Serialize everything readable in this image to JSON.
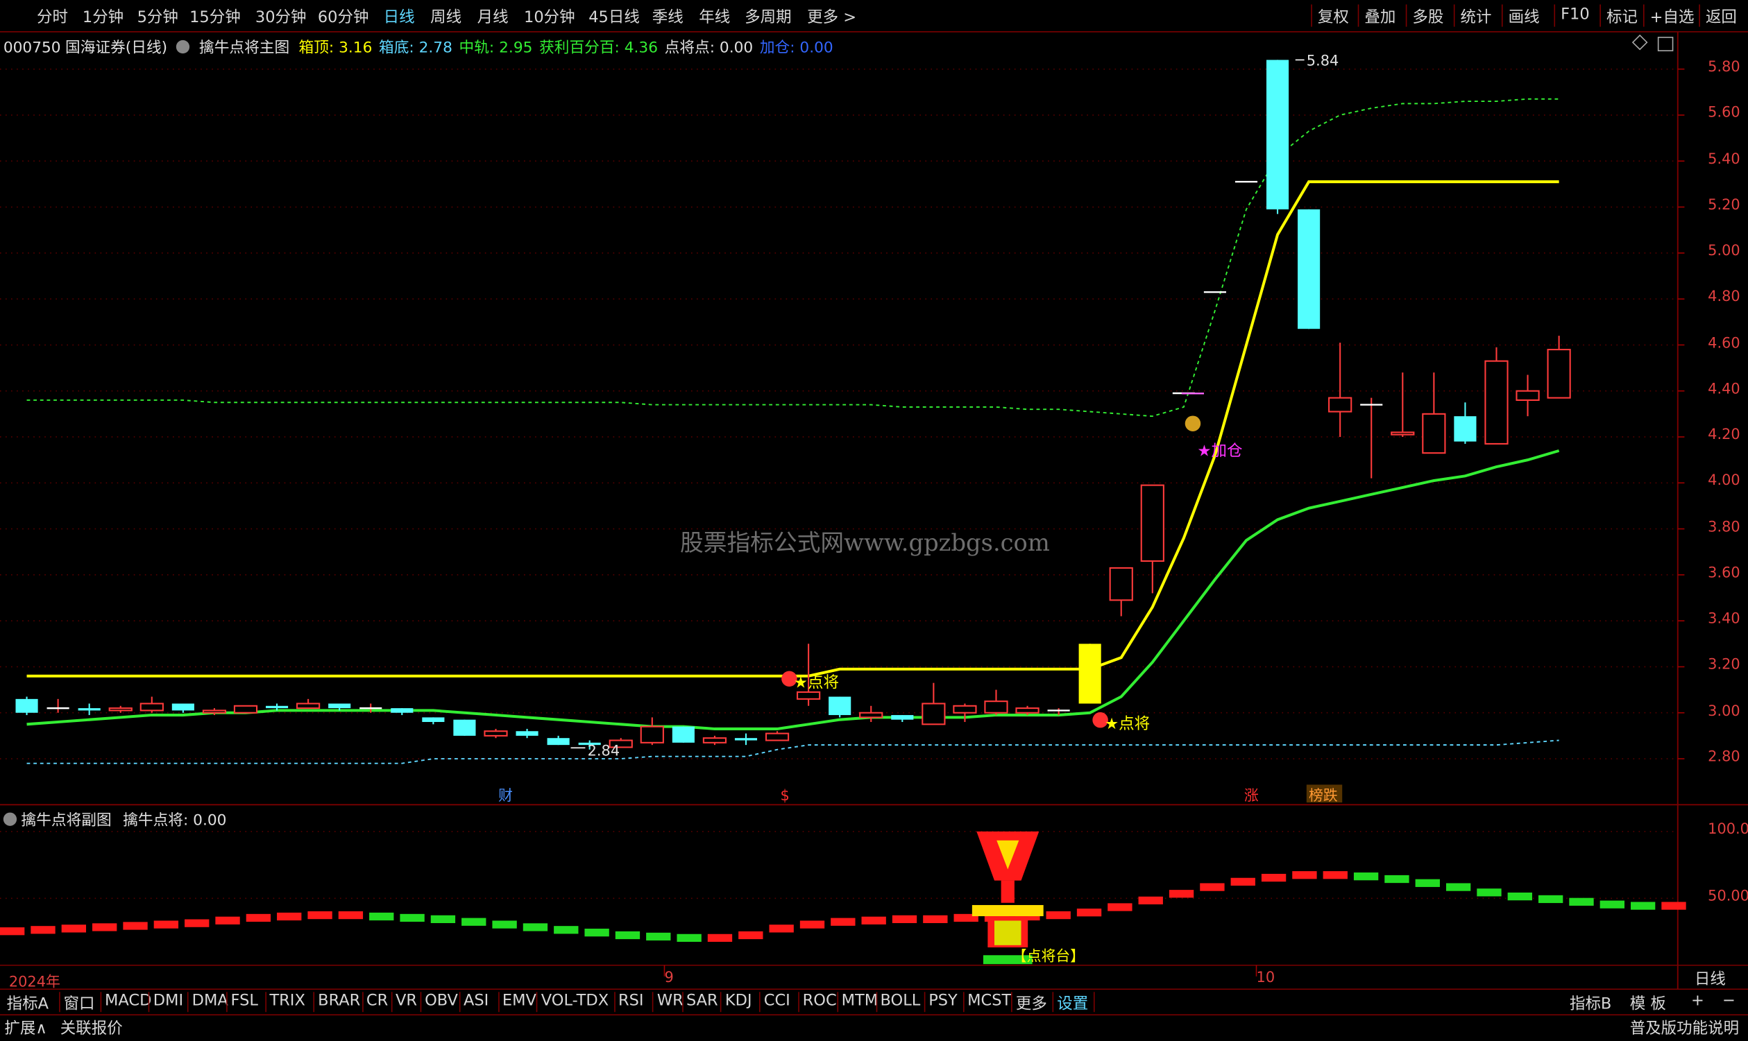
{
  "toolbar": {
    "periods": [
      "分时",
      "1分钟",
      "5分钟",
      "15分钟",
      "30分钟",
      "60分钟",
      "日线",
      "周线",
      "月线",
      "10分钟",
      "45日线",
      "季线",
      "年线",
      "多周期",
      "更多 >"
    ],
    "active_period": "日线",
    "right": [
      "复权",
      "叠加",
      "多股",
      "统计",
      "画线",
      "F10",
      "标记",
      "+自选",
      "返回"
    ]
  },
  "header": {
    "code": "000750",
    "name": "国海证券(日线)",
    "indicator": "擒牛点将主图",
    "items": [
      {
        "label": "箱顶: 3.16",
        "color": "#ffff00"
      },
      {
        "label": "箱底: 2.78",
        "color": "#5fd7ff"
      },
      {
        "label": "中轨: 2.95",
        "color": "#33ee33"
      },
      {
        "label": "获利百分百: 4.36",
        "color": "#33ee33"
      },
      {
        "label": "点将点: 0.00",
        "color": "#e0e0e0"
      },
      {
        "label": "加仓: 0.00",
        "color": "#3366ff"
      }
    ]
  },
  "watermark": "股票指标公式网www.gpzbgs.com",
  "chart_data": [
    {
      "type": "candlestick",
      "title": "擒牛点将主图",
      "ylim": [
        2.7,
        5.9
      ],
      "yticks": [
        "5.80",
        "5.60",
        "5.40",
        "5.20",
        "5.00",
        "4.80",
        "4.60",
        "4.40",
        "4.20",
        "4.00",
        "3.80",
        "3.60",
        "3.40",
        "3.20",
        "3.00",
        "2.80"
      ],
      "candles": [
        {
          "o": 3.06,
          "c": 3.0,
          "h": 3.07,
          "l": 2.99
        },
        {
          "o": 3.02,
          "c": 3.02,
          "h": 3.06,
          "l": 3.0
        },
        {
          "o": 3.02,
          "c": 3.01,
          "h": 3.04,
          "l": 2.99
        },
        {
          "o": 3.01,
          "c": 3.02,
          "h": 3.03,
          "l": 3.0
        },
        {
          "o": 3.01,
          "c": 3.04,
          "h": 3.07,
          "l": 3.0
        },
        {
          "o": 3.04,
          "c": 3.01,
          "h": 3.04,
          "l": 3.0
        },
        {
          "o": 3.0,
          "c": 3.01,
          "h": 3.02,
          "l": 2.99
        },
        {
          "o": 3.0,
          "c": 3.03,
          "h": 3.03,
          "l": 3.0
        },
        {
          "o": 3.03,
          "c": 3.02,
          "h": 3.04,
          "l": 3.01
        },
        {
          "o": 3.02,
          "c": 3.04,
          "h": 3.06,
          "l": 3.02
        },
        {
          "o": 3.04,
          "c": 3.02,
          "h": 3.04,
          "l": 3.01
        },
        {
          "o": 3.02,
          "c": 3.02,
          "h": 3.04,
          "l": 3.0
        },
        {
          "o": 3.02,
          "c": 3.0,
          "h": 3.02,
          "l": 2.99
        },
        {
          "o": 2.98,
          "c": 2.96,
          "h": 2.98,
          "l": 2.95
        },
        {
          "o": 2.97,
          "c": 2.9,
          "h": 2.97,
          "l": 2.9
        },
        {
          "o": 2.9,
          "c": 2.92,
          "h": 2.93,
          "l": 2.89
        },
        {
          "o": 2.92,
          "c": 2.9,
          "h": 2.93,
          "l": 2.89
        },
        {
          "o": 2.89,
          "c": 2.86,
          "h": 2.9,
          "l": 2.86
        },
        {
          "o": 2.87,
          "c": 2.86,
          "h": 2.88,
          "l": 2.84
        },
        {
          "o": 2.85,
          "c": 2.88,
          "h": 2.89,
          "l": 2.85
        },
        {
          "o": 2.87,
          "c": 2.94,
          "h": 2.98,
          "l": 2.86
        },
        {
          "o": 2.94,
          "c": 2.87,
          "h": 2.94,
          "l": 2.87
        },
        {
          "o": 2.87,
          "c": 2.89,
          "h": 2.9,
          "l": 2.86
        },
        {
          "o": 2.89,
          "c": 2.88,
          "h": 2.91,
          "l": 2.86
        },
        {
          "o": 2.88,
          "c": 2.91,
          "h": 2.92,
          "l": 2.88
        },
        {
          "o": 3.06,
          "c": 3.09,
          "h": 3.3,
          "l": 3.03
        },
        {
          "o": 3.07,
          "c": 2.99,
          "h": 3.07,
          "l": 2.98
        },
        {
          "o": 2.98,
          "c": 3.0,
          "h": 3.03,
          "l": 2.96
        },
        {
          "o": 2.99,
          "c": 2.97,
          "h": 2.99,
          "l": 2.96
        },
        {
          "o": 2.95,
          "c": 3.04,
          "h": 3.13,
          "l": 2.95
        },
        {
          "o": 3.0,
          "c": 3.03,
          "h": 3.04,
          "l": 2.96
        },
        {
          "o": 3.0,
          "c": 3.05,
          "h": 3.1,
          "l": 2.99
        },
        {
          "o": 3.0,
          "c": 3.02,
          "h": 3.03,
          "l": 2.99
        },
        {
          "o": 3.01,
          "c": 3.01,
          "h": 3.02,
          "l": 2.99
        },
        {
          "o": 3.04,
          "c": 3.3,
          "h": 3.3,
          "l": 3.04
        },
        {
          "o": 3.49,
          "c": 3.63,
          "h": 3.63,
          "l": 3.42
        },
        {
          "o": 3.66,
          "c": 3.99,
          "h": 3.99,
          "l": 3.52
        },
        {
          "o": 4.39,
          "c": 4.39,
          "h": 4.39,
          "l": 4.39
        },
        {
          "o": 4.83,
          "c": 4.83,
          "h": 4.83,
          "l": 4.83
        },
        {
          "o": 5.31,
          "c": 5.31,
          "h": 5.31,
          "l": 5.31
        },
        {
          "o": 5.84,
          "c": 5.19,
          "h": 5.84,
          "l": 5.17
        },
        {
          "o": 5.19,
          "c": 4.67,
          "h": 5.19,
          "l": 4.67
        },
        {
          "o": 4.31,
          "c": 4.37,
          "h": 4.61,
          "l": 4.2
        },
        {
          "o": 4.34,
          "c": 4.34,
          "h": 4.37,
          "l": 4.02
        },
        {
          "o": 4.21,
          "c": 4.22,
          "h": 4.48,
          "l": 4.2
        },
        {
          "o": 4.13,
          "c": 4.3,
          "h": 4.48,
          "l": 4.13
        },
        {
          "o": 4.29,
          "c": 4.18,
          "h": 4.35,
          "l": 4.17
        },
        {
          "o": 4.17,
          "c": 4.53,
          "h": 4.59,
          "l": 4.17
        },
        {
          "o": 4.36,
          "c": 4.4,
          "h": 4.47,
          "l": 4.29
        },
        {
          "o": 4.37,
          "c": 4.58,
          "h": 4.64,
          "l": 4.37
        }
      ],
      "series": [
        {
          "name": "箱顶",
          "color": "#ffff00",
          "values": [
            3.16,
            3.16,
            3.16,
            3.16,
            3.16,
            3.16,
            3.16,
            3.16,
            3.16,
            3.16,
            3.16,
            3.16,
            3.16,
            3.16,
            3.16,
            3.16,
            3.16,
            3.16,
            3.16,
            3.16,
            3.16,
            3.16,
            3.16,
            3.16,
            3.16,
            3.16,
            3.19,
            3.19,
            3.19,
            3.19,
            3.19,
            3.19,
            3.19,
            3.19,
            3.19,
            3.24,
            3.46,
            3.76,
            4.12,
            4.6,
            5.08,
            5.31,
            5.31,
            5.31,
            5.31,
            5.31,
            5.31,
            5.31,
            5.31,
            5.31
          ]
        },
        {
          "name": "中轨",
          "color": "#33ee33",
          "values": [
            2.95,
            2.96,
            2.97,
            2.98,
            2.99,
            2.99,
            3.0,
            3.0,
            3.01,
            3.01,
            3.01,
            3.01,
            3.01,
            3.01,
            3.0,
            2.99,
            2.98,
            2.97,
            2.96,
            2.95,
            2.94,
            2.94,
            2.93,
            2.93,
            2.93,
            2.95,
            2.97,
            2.98,
            2.98,
            2.98,
            2.98,
            2.99,
            2.99,
            2.99,
            3.0,
            3.07,
            3.22,
            3.4,
            3.58,
            3.75,
            3.84,
            3.89,
            3.92,
            3.95,
            3.98,
            4.01,
            4.03,
            4.07,
            4.1,
            4.14
          ]
        },
        {
          "name": "获利百分百",
          "color": "#33ee33",
          "values": [
            4.36,
            4.36,
            4.36,
            4.36,
            4.36,
            4.36,
            4.35,
            4.35,
            4.35,
            4.35,
            4.35,
            4.35,
            4.35,
            4.35,
            4.35,
            4.35,
            4.35,
            4.35,
            4.35,
            4.35,
            4.34,
            4.34,
            4.34,
            4.34,
            4.34,
            4.34,
            4.34,
            4.34,
            4.33,
            4.33,
            4.33,
            4.33,
            4.32,
            4.32,
            4.31,
            4.3,
            4.29,
            4.33,
            4.75,
            5.19,
            5.42,
            5.53,
            5.6,
            5.63,
            5.65,
            5.65,
            5.66,
            5.66,
            5.67,
            5.67
          ]
        },
        {
          "name": "箱底",
          "color": "#5fd7ff",
          "values": [
            2.78,
            2.78,
            2.78,
            2.78,
            2.78,
            2.78,
            2.78,
            2.78,
            2.78,
            2.78,
            2.78,
            2.78,
            2.78,
            2.8,
            2.8,
            2.8,
            2.8,
            2.8,
            2.8,
            2.8,
            2.81,
            2.81,
            2.81,
            2.81,
            2.84,
            2.86,
            2.86,
            2.86,
            2.86,
            2.86,
            2.86,
            2.86,
            2.86,
            2.86,
            2.86,
            2.86,
            2.86,
            2.86,
            2.86,
            2.86,
            2.86,
            2.86,
            2.86,
            2.86,
            2.86,
            2.86,
            2.86,
            2.86,
            2.87,
            2.88
          ]
        }
      ],
      "annotations": {
        "high": "5.84",
        "low": "2.84",
        "signal1": "★点将",
        "signal2": "★点将",
        "add": "★加仓",
        "events": [
          "财",
          "$",
          "涨",
          "榜跌"
        ]
      }
    },
    {
      "type": "bar",
      "title": "擒牛点将副图",
      "ylim": [
        0,
        120
      ],
      "yticks": [
        "100.0",
        "50.00"
      ],
      "values": [
        25,
        26,
        27,
        28,
        29,
        30,
        31,
        33,
        35,
        36,
        37,
        37,
        36,
        35,
        34,
        32,
        30,
        28,
        26,
        24,
        22,
        21,
        20,
        20,
        22,
        27,
        30,
        32,
        33,
        34,
        34,
        35,
        35,
        36,
        37,
        39,
        43,
        48,
        53,
        58,
        62,
        65,
        67,
        67,
        66,
        64,
        61,
        58,
        54,
        51,
        49,
        47,
        45,
        44,
        44
      ],
      "up_color": "#ff1a1a",
      "down_color": "#22dd22",
      "label": "【点将台】"
    }
  ],
  "subpanel": {
    "title": "擒牛点将副图",
    "value_label": "擒牛点将: 0.00"
  },
  "xaxis": {
    "labels": [
      "2024年",
      "9",
      "10"
    ],
    "period_label": "日线"
  },
  "indicator_tabs": [
    "指标A",
    "窗口",
    "MACD",
    "DMI",
    "DMA",
    "FSL",
    "TRIX",
    "BRAR",
    "CR",
    "VR",
    "OBV",
    "ASI",
    "EMV",
    "VOL-TDX",
    "RSI",
    "WR",
    "SAR",
    "KDJ",
    "CCI",
    "ROC",
    "MTM",
    "BOLL",
    "PSY",
    "MCST",
    "更多",
    "设置"
  ],
  "tabs_right": [
    "指标B",
    "模 板",
    "+",
    "−"
  ],
  "statusbar": {
    "expand": "扩展∧",
    "quote": "关联报价",
    "help": "普及版功能说明"
  }
}
